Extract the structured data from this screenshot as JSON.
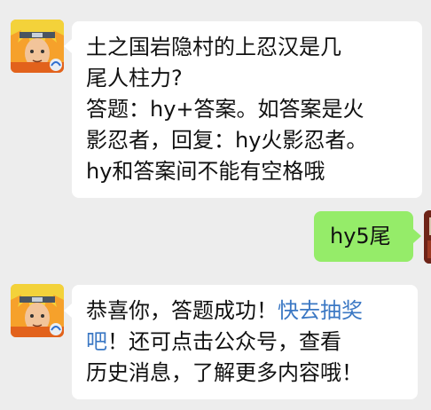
{
  "conversation": {
    "messages": [
      {
        "sender": "official-account",
        "lines": [
          "土之国岩隐村的上忍汉是几",
          "尾人柱力?",
          "答题：hy+答案。如答案是火",
          "影忍者，回复：hy火影忍者。",
          "hy和答案间不能有空格哦"
        ]
      },
      {
        "sender": "user",
        "text": "hy5尾"
      },
      {
        "sender": "official-account",
        "part1": "恭喜你，答题成功！",
        "link": "快去抽奖",
        "link2": "吧",
        "part2": "！还可点击公众号，查看",
        "part3": "历史消息，了解更多内容哦！"
      }
    ]
  },
  "colors": {
    "background": "#ededed",
    "incoming_bubble": "#ffffff",
    "outgoing_bubble": "#95ec69",
    "link": "#3b78c4"
  },
  "icons": {
    "account_avatar": "naruto-avatar-icon",
    "user_avatar": "user-avatar-icon"
  }
}
